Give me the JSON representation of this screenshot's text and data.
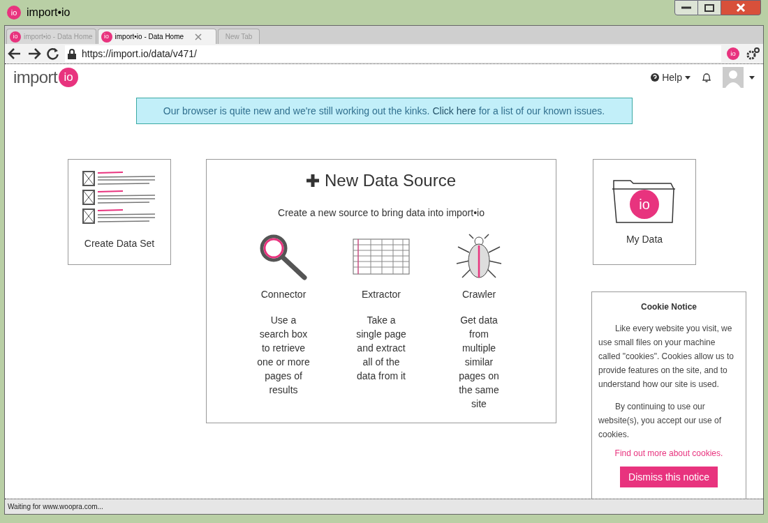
{
  "window": {
    "app_badge": "io",
    "title": "import•io"
  },
  "tabs": [
    {
      "badge": "io",
      "label": "import•io - Data Home",
      "selected": false
    },
    {
      "badge": "io",
      "label": "import•io - Data Home",
      "selected": true,
      "closable": true
    },
    {
      "label": "New Tab",
      "selected": false
    }
  ],
  "address_bar": {
    "url": "https://import.io/data/v471/",
    "ext_badge": "io"
  },
  "header": {
    "logo_text": "import",
    "logo_badge": "io",
    "help": "Help"
  },
  "banner": {
    "before": "Our browser is quite new and we're still working out the kinks.",
    "link": "Click here",
    "after": "for a list of our known issues."
  },
  "left_card": {
    "label": "Create Data Set"
  },
  "center_card": {
    "title": "New Data Source",
    "subtitle": "Create a new source to bring data into import•io",
    "options": [
      {
        "kind": "connector",
        "name": "Connector",
        "description": "Use a search box to retrieve one or more pages of results"
      },
      {
        "kind": "extractor",
        "name": "Extractor",
        "description": "Take a single page and extract all of the data from it"
      },
      {
        "kind": "crawler",
        "name": "Crawler",
        "description": "Get data from multiple similar pages on the same site"
      }
    ]
  },
  "right_card": {
    "label": "My Data",
    "badge": "io"
  },
  "cookie_notice": {
    "title": "Cookie Notice",
    "paragraphs": [
      "Like every website you visit, we use small files on your machine called \"cookies\". Cookies allow us to provide features on the site, and to understand how our site is used.",
      "By continuing to use our website(s), you accept our use of cookies."
    ],
    "link": "Find out more about cookies.",
    "button": "Dismiss this notice"
  },
  "status_bar": "Waiting for www.woopra.com..."
}
